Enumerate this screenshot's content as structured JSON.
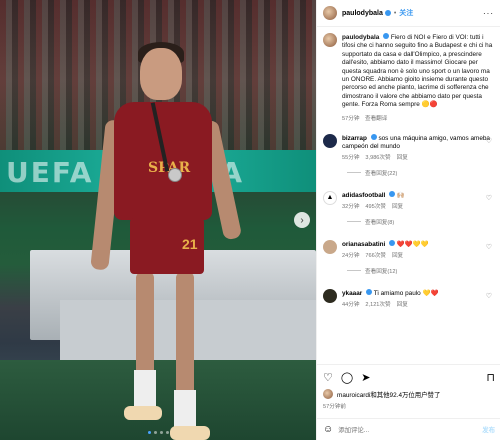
{
  "photo": {
    "banner_text": "UEFA EUROPA",
    "shirt_sponsor": "SPAR",
    "shirt_number": "21"
  },
  "header": {
    "username": "paulodybala",
    "follow_label": "关注",
    "more_label": "···"
  },
  "caption": {
    "username": "paulodybala",
    "text": "Fiero di NOI e Fiero di VOI: tutti i tifosi che ci hanno seguito fino a Budapest e chi ci ha supportato da casa e dall'Olimpico, a prescindere dall'esito, abbiamo dato il massimo! Giocare per questa squadra non è solo uno sport o un lavoro ma un ONORE. Abbiamo gioito insieme durante questo percorso ed anche pianto, lacrime di sofferenza che dimostrano il valore che abbiamo dato per questa gente. Forza Roma sempre",
    "emojis": "🟡🔴",
    "time": "57分钟",
    "translate": "查看翻译"
  },
  "comments": [
    {
      "username": "bizarrap",
      "text": "sos una máquina amigo, vamos ameba campeón del mundo",
      "time": "55分钟",
      "likes": "3,986次赞",
      "reply": "回复",
      "view_replies": "查看回复(22)",
      "avatar_color": "#1d2a4a"
    },
    {
      "username": "adidasfootball",
      "text": "🙌🏼",
      "time": "32分钟",
      "likes": "495次赞",
      "reply": "回复",
      "view_replies": "查看回复(8)",
      "avatar_color": "#ffffff"
    },
    {
      "username": "orianasabatini",
      "text": "❤️❤️💛💛",
      "time": "24分钟",
      "likes": "766次赞",
      "reply": "回复",
      "view_replies": "查看回复(12)",
      "avatar_color": "#c9a88a"
    },
    {
      "username": "ykaaar",
      "text": "Ti amiamo paulo 💛❤️",
      "time": "44分钟",
      "likes": "2,121次赞",
      "reply": "回复",
      "view_replies": "",
      "avatar_color": "#2d2b1f"
    }
  ],
  "actions": {
    "liked_by": "mauroicardi和其他92.4万位用户赞了",
    "date": "57分钟前"
  },
  "comment_box": {
    "placeholder": "添加评论...",
    "post_label": "发布"
  }
}
